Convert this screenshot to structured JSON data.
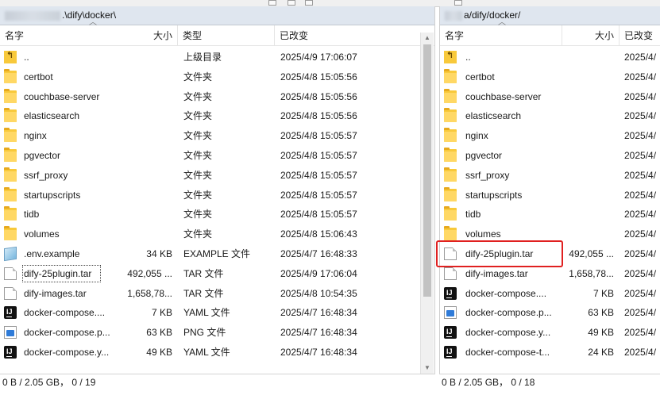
{
  "left": {
    "path": ".\\dify\\docker\\",
    "headers": {
      "name": "名字",
      "size": "大小",
      "type": "类型",
      "modified": "已改变"
    },
    "rows": [
      {
        "icon": "up-folder-icon",
        "name": "..",
        "size": "",
        "type": "上级目录",
        "modified": "2025/4/9 17:06:07"
      },
      {
        "icon": "folder-icon",
        "name": "certbot",
        "size": "",
        "type": "文件夹",
        "modified": "2025/4/8 15:05:56"
      },
      {
        "icon": "folder-icon",
        "name": "couchbase-server",
        "size": "",
        "type": "文件夹",
        "modified": "2025/4/8 15:05:56"
      },
      {
        "icon": "folder-icon",
        "name": "elasticsearch",
        "size": "",
        "type": "文件夹",
        "modified": "2025/4/8 15:05:56"
      },
      {
        "icon": "folder-icon",
        "name": "nginx",
        "size": "",
        "type": "文件夹",
        "modified": "2025/4/8 15:05:57"
      },
      {
        "icon": "folder-icon",
        "name": "pgvector",
        "size": "",
        "type": "文件夹",
        "modified": "2025/4/8 15:05:57"
      },
      {
        "icon": "folder-icon",
        "name": "ssrf_proxy",
        "size": "",
        "type": "文件夹",
        "modified": "2025/4/8 15:05:57"
      },
      {
        "icon": "folder-icon",
        "name": "startupscripts",
        "size": "",
        "type": "文件夹",
        "modified": "2025/4/8 15:05:57"
      },
      {
        "icon": "folder-icon",
        "name": "tidb",
        "size": "",
        "type": "文件夹",
        "modified": "2025/4/8 15:05:57"
      },
      {
        "icon": "folder-icon",
        "name": "volumes",
        "size": "",
        "type": "文件夹",
        "modified": "2025/4/8 15:06:43"
      },
      {
        "icon": "env-file-icon",
        "name": ".env.example",
        "size": "34 KB",
        "type": "EXAMPLE 文件",
        "modified": "2025/4/7 16:48:33"
      },
      {
        "icon": "file-icon",
        "name": "dify-25plugin.tar",
        "size": "492,055 ...",
        "type": "TAR 文件",
        "modified": "2025/4/9 17:06:04"
      },
      {
        "icon": "file-icon",
        "name": "dify-images.tar",
        "size": "1,658,78...",
        "type": "TAR 文件",
        "modified": "2025/4/8 10:54:35"
      },
      {
        "icon": "intellij-icon",
        "name": "docker-compose....",
        "size": "7 KB",
        "type": "YAML 文件",
        "modified": "2025/4/7 16:48:34"
      },
      {
        "icon": "png-file-icon",
        "name": "docker-compose.p...",
        "size": "63 KB",
        "type": "PNG 文件",
        "modified": "2025/4/7 16:48:34"
      },
      {
        "icon": "intellij-icon",
        "name": "docker-compose.y...",
        "size": "49 KB",
        "type": "YAML 文件",
        "modified": "2025/4/7 16:48:34"
      }
    ],
    "status": "0 B / 2.05 GB， 0 / 19"
  },
  "right": {
    "path": "a/dify/docker/",
    "headers": {
      "name": "名字",
      "size": "大小",
      "modified": "已改变"
    },
    "rows": [
      {
        "icon": "up-folder-icon",
        "name": "..",
        "size": "",
        "modified": "2025/4/"
      },
      {
        "icon": "folder-icon",
        "name": "certbot",
        "size": "",
        "modified": "2025/4/"
      },
      {
        "icon": "folder-icon",
        "name": "couchbase-server",
        "size": "",
        "modified": "2025/4/"
      },
      {
        "icon": "folder-icon",
        "name": "elasticsearch",
        "size": "",
        "modified": "2025/4/"
      },
      {
        "icon": "folder-icon",
        "name": "nginx",
        "size": "",
        "modified": "2025/4/"
      },
      {
        "icon": "folder-icon",
        "name": "pgvector",
        "size": "",
        "modified": "2025/4/"
      },
      {
        "icon": "folder-icon",
        "name": "ssrf_proxy",
        "size": "",
        "modified": "2025/4/"
      },
      {
        "icon": "folder-icon",
        "name": "startupscripts",
        "size": "",
        "modified": "2025/4/"
      },
      {
        "icon": "folder-icon",
        "name": "tidb",
        "size": "",
        "modified": "2025/4/"
      },
      {
        "icon": "folder-icon",
        "name": "volumes",
        "size": "",
        "modified": "2025/4/"
      },
      {
        "icon": "file-icon",
        "name": "dify-25plugin.tar",
        "size": "492,055 ...",
        "modified": "2025/4/"
      },
      {
        "icon": "file-icon",
        "name": "dify-images.tar",
        "size": "1,658,78...",
        "modified": "2025/4/"
      },
      {
        "icon": "intellij-icon",
        "name": "docker-compose....",
        "size": "7 KB",
        "modified": "2025/4/"
      },
      {
        "icon": "png-file-icon",
        "name": "docker-compose.p...",
        "size": "63 KB",
        "modified": "2025/4/"
      },
      {
        "icon": "intellij-icon",
        "name": "docker-compose.y...",
        "size": "49 KB",
        "modified": "2025/4/"
      },
      {
        "icon": "intellij-icon",
        "name": "docker-compose-t...",
        "size": "24 KB",
        "modified": "2025/4/"
      }
    ],
    "status": "0 B / 2.05 GB， 0 / 18"
  },
  "colors": {
    "path_bar": "#dfe6ef",
    "highlight_box": "#e02020",
    "folder": "#f8c93b"
  }
}
